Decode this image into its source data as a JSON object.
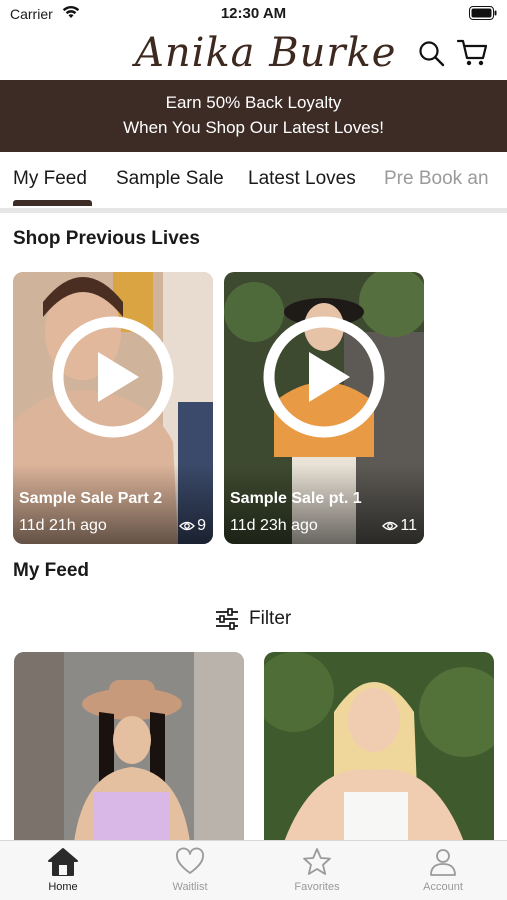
{
  "status_bar": {
    "carrier": "Carrier",
    "time": "12:30 AM"
  },
  "header": {
    "brand": "Anika Burke"
  },
  "promo": {
    "line1": "Earn 50% Back Loyalty",
    "line2": "When You Shop Our Latest Loves!"
  },
  "tabs": [
    {
      "label": "My Feed",
      "active": true
    },
    {
      "label": "Sample Sale"
    },
    {
      "label": "Latest Loves"
    },
    {
      "label": "Pre Book an"
    }
  ],
  "previous_lives": {
    "title": "Shop Previous Lives",
    "videos": [
      {
        "title": "Sample Sale Part 2",
        "time": "11d 21h ago",
        "views": "9"
      },
      {
        "title": "Sample Sale pt. 1",
        "time": "11d 23h ago",
        "views": "11"
      }
    ]
  },
  "feed": {
    "title": "My Feed",
    "filter_label": "Filter"
  },
  "tab_bar": [
    {
      "label": "Home",
      "icon": "home-icon",
      "active": true
    },
    {
      "label": "Waitlist",
      "icon": "heart-icon"
    },
    {
      "label": "Favorites",
      "icon": "star-icon"
    },
    {
      "label": "Account",
      "icon": "person-icon"
    }
  ],
  "colors": {
    "brand_dark": "#3d2b25",
    "tab_inactive": "#9a9a9a"
  }
}
